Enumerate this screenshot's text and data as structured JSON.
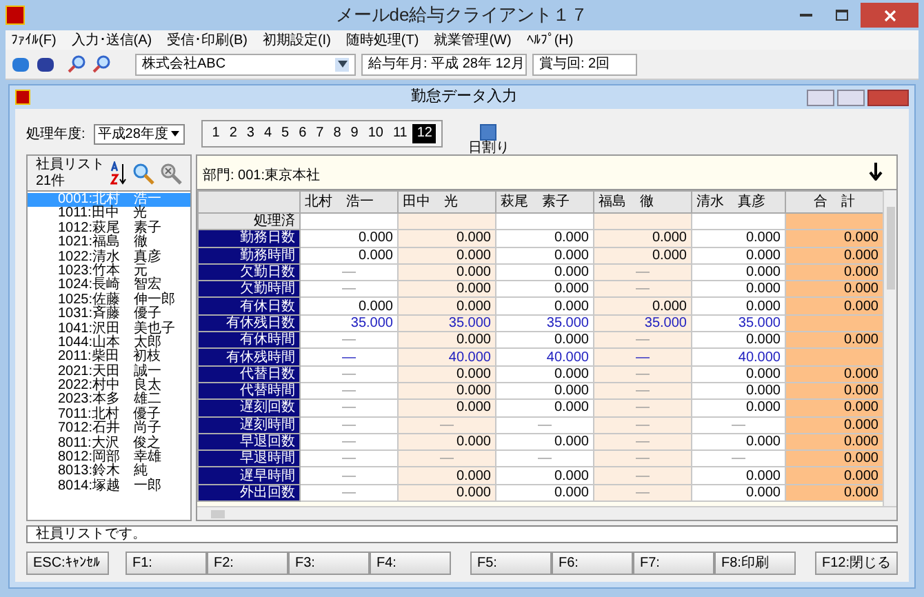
{
  "window": {
    "title": "メールde給与クライアント１７"
  },
  "menu": [
    "ﾌｧｲﾙ(F)",
    "入力･送信(A)",
    "受信･印刷(B)",
    "初期設定(I)",
    "随時処理(T)",
    "就業管理(W)",
    "ﾍﾙﾌﾟ(H)"
  ],
  "toolbar": {
    "company": "株式会社ABC",
    "pay_month": "給与年月: 平成 28年 12月",
    "bonus": "賞与回: 2回"
  },
  "inner_window": {
    "title": "勤怠データ入力"
  },
  "year": {
    "label": "処理年度:",
    "value": "平成28年度"
  },
  "months": [
    {
      "label": "1",
      "selected": false
    },
    {
      "label": "2",
      "selected": false
    },
    {
      "label": "3",
      "selected": false
    },
    {
      "label": "4",
      "selected": false
    },
    {
      "label": "5",
      "selected": false
    },
    {
      "label": "6",
      "selected": false
    },
    {
      "label": "7",
      "selected": false
    },
    {
      "label": "8",
      "selected": false
    },
    {
      "label": "9",
      "selected": false
    },
    {
      "label": "10",
      "selected": false
    },
    {
      "label": "11",
      "selected": false
    },
    {
      "label": "12",
      "selected": true
    }
  ],
  "day_split": {
    "label": "日割り"
  },
  "employee_list": {
    "title": "社員リスト",
    "count": "21件",
    "items": [
      {
        "label": "0001:北村　浩一",
        "selected": true
      },
      {
        "label": "1011:田中　光",
        "selected": false
      },
      {
        "label": "1012:萩尾　素子",
        "selected": false
      },
      {
        "label": "1021:福島　徹",
        "selected": false
      },
      {
        "label": "1022:清水　真彦",
        "selected": false
      },
      {
        "label": "1023:竹本　元",
        "selected": false
      },
      {
        "label": "1024:長崎　智宏",
        "selected": false
      },
      {
        "label": "1025:佐藤　伸一郎",
        "selected": false
      },
      {
        "label": "1031:斉藤　優子",
        "selected": false
      },
      {
        "label": "1041:沢田　美也子",
        "selected": false
      },
      {
        "label": "1044:山本　太郎",
        "selected": false
      },
      {
        "label": "2011:柴田　初枝",
        "selected": false
      },
      {
        "label": "2021:天田　誠一",
        "selected": false
      },
      {
        "label": "2022:村中　良太",
        "selected": false
      },
      {
        "label": "2023:本多　雄二",
        "selected": false
      },
      {
        "label": "7011:北村　優子",
        "selected": false
      },
      {
        "label": "7012:石井　尚子",
        "selected": false
      },
      {
        "label": "8011:大沢　俊之",
        "selected": false
      },
      {
        "label": "8012:岡部　幸雄",
        "selected": false
      },
      {
        "label": "8013:鈴木　純",
        "selected": false
      },
      {
        "label": "8014:塚越　一郎",
        "selected": false
      }
    ]
  },
  "department": "部門: 001:東京本社",
  "table": {
    "columns": [
      {
        "label": "北村　浩一",
        "kind": "employee"
      },
      {
        "label": "田中　光",
        "kind": "employee"
      },
      {
        "label": "萩尾　素子",
        "kind": "employee"
      },
      {
        "label": "福島　徹",
        "kind": "employee"
      },
      {
        "label": "清水　真彦",
        "kind": "employee"
      },
      {
        "label": "合　計",
        "kind": "total"
      }
    ],
    "rows": [
      {
        "label": "処理済",
        "kind": "status",
        "cells": [
          null,
          null,
          null,
          null,
          null,
          null
        ]
      },
      {
        "label": "勤務日数",
        "kind": "normal",
        "cells": [
          "0.000",
          "0.000",
          "0.000",
          "0.000",
          "0.000",
          "0.000"
        ]
      },
      {
        "label": "勤務時間",
        "kind": "normal",
        "cells": [
          "0.000",
          "0.000",
          "0.000",
          "0.000",
          "0.000",
          "0.000"
        ]
      },
      {
        "label": "欠勤日数",
        "kind": "normal",
        "cells": [
          "—",
          "0.000",
          "0.000",
          "—",
          "0.000",
          "0.000"
        ]
      },
      {
        "label": "欠勤時間",
        "kind": "normal",
        "cells": [
          "—",
          "0.000",
          "0.000",
          "—",
          "0.000",
          "0.000"
        ]
      },
      {
        "label": "有休日数",
        "kind": "normal",
        "cells": [
          "0.000",
          "0.000",
          "0.000",
          "0.000",
          "0.000",
          "0.000"
        ]
      },
      {
        "label": "有休残日数",
        "kind": "remaining",
        "cells": [
          "35.000",
          "35.000",
          "35.000",
          "35.000",
          "35.000",
          null
        ]
      },
      {
        "label": "有休時間",
        "kind": "normal",
        "cells": [
          "—",
          "0.000",
          "0.000",
          "—",
          "0.000",
          "0.000"
        ]
      },
      {
        "label": "有休残時間",
        "kind": "remaining",
        "cells": [
          "—",
          "40.000",
          "40.000",
          "—",
          "40.000",
          null
        ]
      },
      {
        "label": "代替日数",
        "kind": "normal",
        "cells": [
          "—",
          "0.000",
          "0.000",
          "—",
          "0.000",
          "0.000"
        ]
      },
      {
        "label": "代替時間",
        "kind": "normal",
        "cells": [
          "—",
          "0.000",
          "0.000",
          "—",
          "0.000",
          "0.000"
        ]
      },
      {
        "label": "遅刻回数",
        "kind": "normal",
        "cells": [
          "—",
          "0.000",
          "0.000",
          "—",
          "0.000",
          "0.000"
        ]
      },
      {
        "label": "遅刻時間",
        "kind": "normal",
        "cells": [
          "—",
          "—",
          "—",
          "—",
          "—",
          "0.000"
        ]
      },
      {
        "label": "早退回数",
        "kind": "normal",
        "cells": [
          "—",
          "0.000",
          "0.000",
          "—",
          "0.000",
          "0.000"
        ]
      },
      {
        "label": "早退時間",
        "kind": "normal",
        "cells": [
          "—",
          "—",
          "—",
          "—",
          "—",
          "0.000"
        ]
      },
      {
        "label": "遅早時間",
        "kind": "normal",
        "cells": [
          "—",
          "0.000",
          "0.000",
          "—",
          "0.000",
          "0.000"
        ]
      },
      {
        "label": "外出回数",
        "kind": "normal",
        "cells": [
          "—",
          "0.000",
          "0.000",
          "—",
          "0.000",
          "0.000"
        ]
      }
    ]
  },
  "status_text": "社員リストです。",
  "buttons": [
    "ESC:ｷｬﾝｾﾙ",
    "F1:",
    "F2:",
    "F3:",
    "F4:",
    "F5:",
    "F6:",
    "F7:",
    "F8:印刷",
    "F12:閉じる"
  ]
}
